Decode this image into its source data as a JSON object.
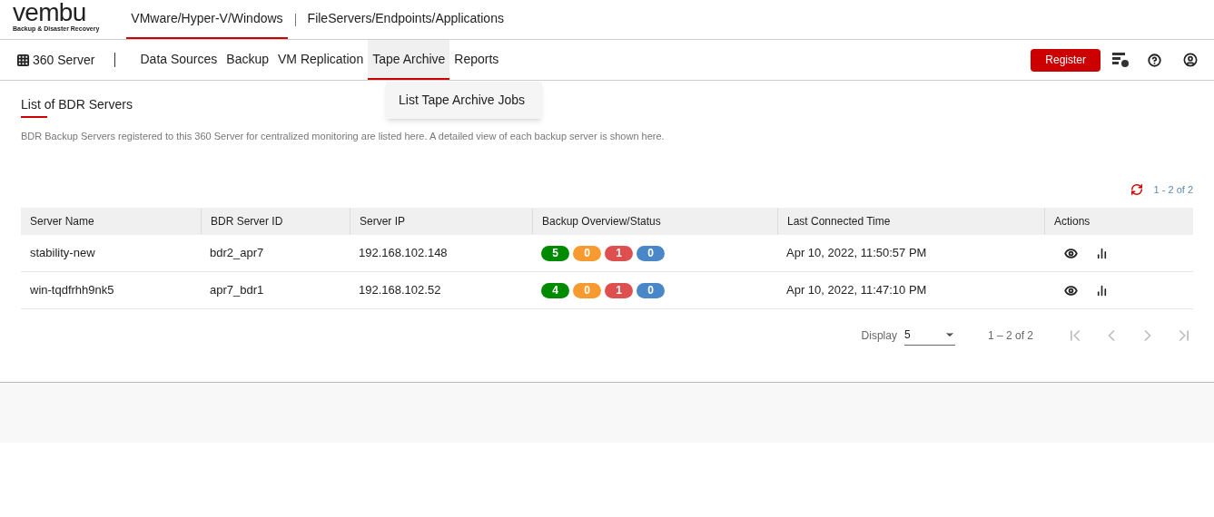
{
  "logo": {
    "name": "vembu",
    "tagline": "Backup & Disaster Recovery"
  },
  "top_tabs": [
    {
      "label": "VMware/Hyper-V/Windows",
      "selected": true
    },
    {
      "label": "FileServers/Endpoints/Applications",
      "selected": false
    }
  ],
  "nav": {
    "home": "360 Server",
    "items": [
      {
        "label": "Data Sources",
        "selected": false
      },
      {
        "label": "Backup",
        "selected": false
      },
      {
        "label": "VM Replication",
        "selected": false
      },
      {
        "label": "Tape Archive",
        "selected": true
      },
      {
        "label": "Reports",
        "selected": false
      }
    ],
    "register": "Register"
  },
  "dropdown": [
    "List Tape Archive Jobs"
  ],
  "page": {
    "title": "List of BDR Servers",
    "description": "BDR Backup Servers registered to this 360 Server for centralized monitoring are listed here. A detailed view of each backup server is shown here.",
    "count": "1 - 2 of 2"
  },
  "table": {
    "columns": [
      "Server Name",
      "BDR Server ID",
      "Server IP",
      "Backup Overview/Status",
      "Last Connected Time",
      "Actions"
    ],
    "rows": [
      {
        "name": "stability-new",
        "id": "bdr2_apr7",
        "ip": "192.168.102.148",
        "status": [
          {
            "value": "5",
            "color": "#008a00"
          },
          {
            "value": "0",
            "color": "#f79a2f"
          },
          {
            "value": "1",
            "color": "#de5050"
          },
          {
            "value": "0",
            "color": "#4a87c8"
          }
        ],
        "time": "Apr 10, 2022, 11:50:57 PM"
      },
      {
        "name": "win-tqdfrhh9nk5",
        "id": "apr7_bdr1",
        "ip": "192.168.102.52",
        "status": [
          {
            "value": "4",
            "color": "#008a00"
          },
          {
            "value": "0",
            "color": "#f79a2f"
          },
          {
            "value": "1",
            "color": "#de5050"
          },
          {
            "value": "0",
            "color": "#4a87c8"
          }
        ],
        "time": "Apr 10, 2022, 11:47:10 PM"
      }
    ]
  },
  "pagination": {
    "display_label": "Display",
    "page_size": "5",
    "range": "1 – 2 of 2"
  }
}
